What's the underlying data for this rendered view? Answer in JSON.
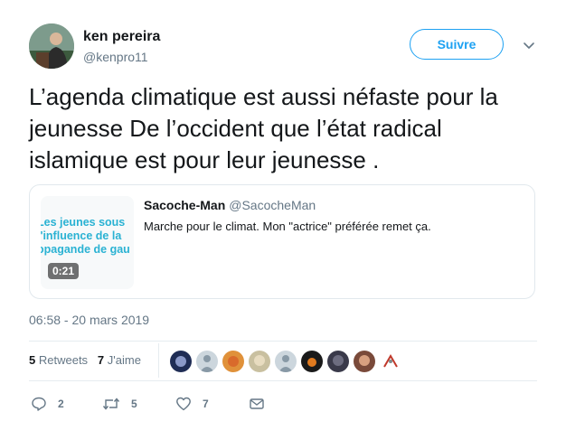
{
  "author": {
    "name": "ken pereira",
    "handle": "@kenpro11",
    "follow_label": "Suivre"
  },
  "tweet": {
    "text": "L’agenda climatique est aussi néfaste pour la jeunesse De l’occident que l’état radical islamique est pour leur jeunesse ."
  },
  "quoted": {
    "name": "Sacoche-Man",
    "handle": "@SacocheMan",
    "text": "Marche pour le climat. Mon \"actrice\" préférée remet ça.",
    "thumbnail_text": [
      "Les jeunes sous",
      "l'influence de la",
      "opagande de gau"
    ],
    "video_duration": "0:21"
  },
  "timestamp": "06:58 - 20 mars 2019",
  "stats": {
    "retweets_count": "5",
    "retweets_label": "Retweets",
    "likes_count": "7",
    "likes_label": "J'aime"
  },
  "actions": {
    "reply_count": "2",
    "retweet_count": "5",
    "like_count": "7"
  },
  "colors": {
    "accent": "#1da1f2",
    "secondary_text": "#657786",
    "border": "#e1e8ed"
  }
}
